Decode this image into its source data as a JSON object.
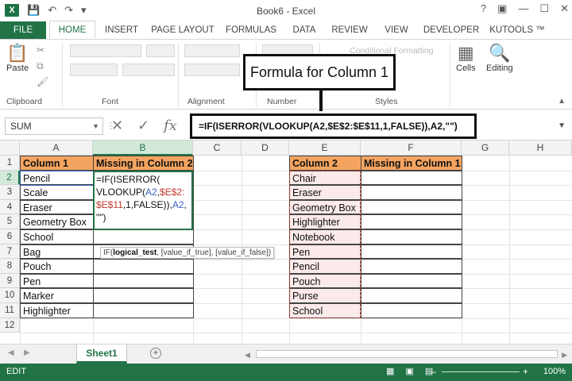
{
  "window": {
    "title": "Book6 - Excel",
    "controls": [
      "?",
      "▣",
      "—",
      "☐",
      "✕"
    ]
  },
  "tabs": {
    "file": "FILE",
    "items": [
      "HOME",
      "INSERT",
      "PAGE LAYOUT",
      "FORMULAS",
      "DATA",
      "REVIEW",
      "VIEW",
      "DEVELOPER",
      "KUTOOLS ™"
    ]
  },
  "ribbon": {
    "paste": "Paste",
    "clipboard": "Clipboard",
    "font": "Font",
    "alignment": "Alignment",
    "number": "Number",
    "styles": "Styles",
    "cells": "Cells",
    "editing": "Editing",
    "ghost_conditional": "Conditional Formatting"
  },
  "callout": {
    "label": "Formula for Column 1"
  },
  "formula_bar": {
    "namebox": "SUM",
    "cancel": "✕",
    "enter": "✓",
    "fx": "fx",
    "formula": "=IF(ISERROR(VLOOKUP(A2,$E$2:$E$11,1,FALSE)),A2,\"\")"
  },
  "grid": {
    "columns": [
      "A",
      "B",
      "C",
      "D",
      "E",
      "F",
      "G",
      "H"
    ],
    "rows": [
      "1",
      "2",
      "3",
      "4",
      "5",
      "6",
      "7",
      "8",
      "9",
      "10",
      "11",
      "12"
    ],
    "col1_header": "Column 1",
    "missing2_header": "Missing in Column 2",
    "col2_header": "Column 2",
    "missing1_header": "Missing in Column 1",
    "column1": [
      "Pencil",
      "Scale",
      "Eraser",
      "Geometry Box",
      "School",
      "Bag",
      "Pouch",
      "Pen",
      "Marker",
      "Highlighter"
    ],
    "column2": [
      "Chair",
      "Eraser",
      "Geometry Box",
      "Highlighter",
      "Notebook",
      "Pen",
      "Pencil",
      "Pouch",
      "Purse",
      "School"
    ],
    "cell_edit": {
      "l1": "=IF(ISERROR(",
      "l2a": "VLOOKUP(",
      "l2b": "A2",
      "l2c": ",",
      "l2d": "$E$2:",
      "l3a": "$E$11",
      "l3b": ",1,FALSE)),",
      "l3c": "A2",
      "l3d": ",",
      "l4": "\"\")"
    },
    "tooltip": {
      "fn": "IF(",
      "arg1": "logical_test",
      "rest": ", [value_if_true], [value_if_false])"
    }
  },
  "sheets": {
    "active": "Sheet1",
    "add": "+"
  },
  "status": {
    "mode": "EDIT",
    "zoom": "100%"
  }
}
